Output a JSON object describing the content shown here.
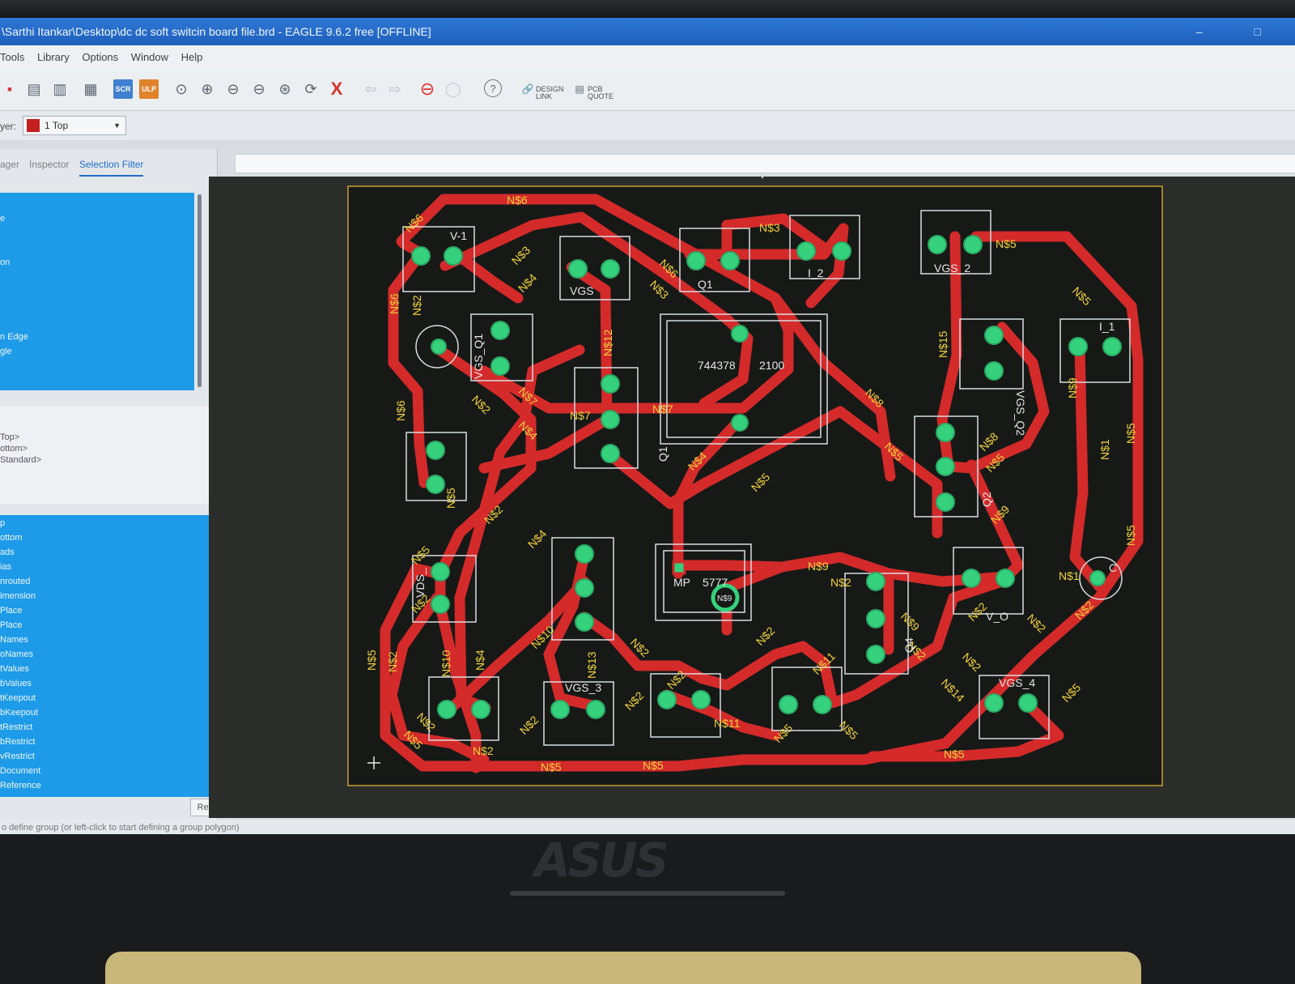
{
  "window": {
    "title": "\\Sarthi Itankar\\Desktop\\dc dc soft switcin board file.brd - EAGLE 9.6.2 free [OFFLINE]",
    "controls": "– □"
  },
  "menu": [
    "Tools",
    "Library",
    "Options",
    "Window",
    "Help"
  ],
  "toolbar": {
    "scr_label": "SCR",
    "ulp_label": "ULP",
    "help_label": "?",
    "design_link": "DESIGN LINK",
    "pcb_quote": "PCB QUOTE"
  },
  "layer": {
    "label": "yer:",
    "selected": "1 Top",
    "color": "#c42020"
  },
  "left_panel": {
    "tabs": [
      "ager",
      "Inspector",
      "Selection Filter"
    ],
    "active_tab": "Selection Filter",
    "top_list": [
      "e",
      "on",
      "n Edge",
      "gle"
    ],
    "mid_list": [
      "Top>",
      "ottom>",
      "Standard>"
    ],
    "layer_list": [
      "p",
      "ottom",
      "ads",
      "ias",
      "nrouted",
      "imension",
      "Place",
      "Place",
      "Names",
      "oNames",
      "tValues",
      "bValues",
      "tKeepout",
      "bKeepout",
      "tRestrict",
      "bRestrict",
      "vRestrict",
      "Document",
      "Reference"
    ],
    "reset_label": "Reset"
  },
  "status": "o define group (or left-click to start defining a group polygon)",
  "board": {
    "trace_color": "#d42a2a",
    "pad_color": "#35d17c",
    "text_color": "#f0d23c",
    "outline_color": "#c8a030",
    "labels": {
      "v1": "V-1",
      "vgs_top": "VGS",
      "q1": "Q1",
      "i2": "I_2",
      "vgs2": "VGS_2",
      "vgs_q1": "VGS_Q1",
      "ic": "744378",
      "ic2": "2100",
      "vgs_q2": "VGS_Q2",
      "i1": "I_1",
      "q1b": "Q1",
      "mp": "MP",
      "mp2": "5777",
      "mp3": "N$9",
      "q2": "Q2",
      "vds": "VDS_",
      "q4": "Q4",
      "vgs3": "VGS_3",
      "vgs4": "VGS_4",
      "vo": "V_O",
      "c": "C"
    },
    "nets": {
      "n6": "N$6",
      "n3": "N$3",
      "n5": "N$5",
      "n4": "N$4",
      "n2": "N$2",
      "n12": "N$12",
      "n7": "N$7",
      "n8": "N$8",
      "n15": "N$15",
      "n9": "N$9",
      "n1": "N$1",
      "n10": "N$10",
      "n13": "N$13",
      "n11": "N$11",
      "n14": "N$14"
    }
  },
  "brand": "ASUS"
}
